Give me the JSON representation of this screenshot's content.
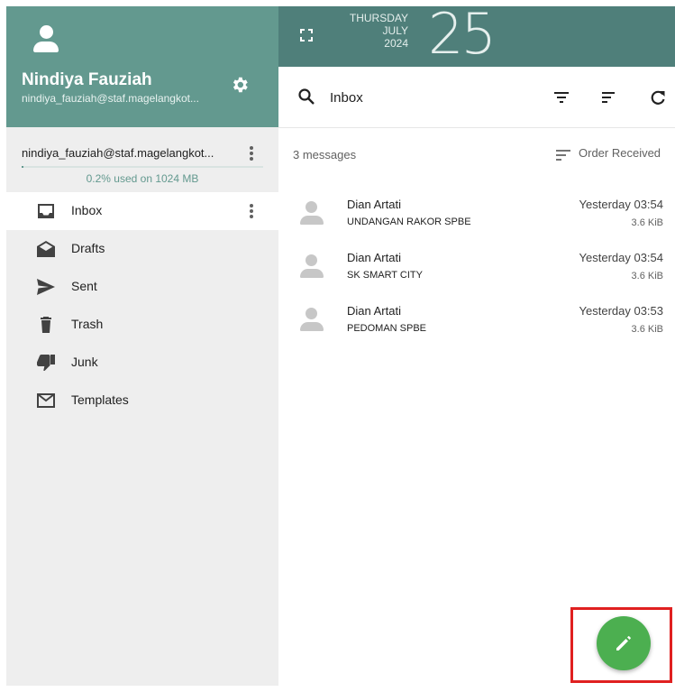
{
  "user": {
    "name": "Nindiya Fauziah",
    "email_header": "nindiya_fauziah@staf.magelangkot..."
  },
  "account": {
    "email": "nindiya_fauziah@staf.magelangkot...",
    "quota_text": "0.2% used on 1024 MB",
    "quota_fraction": 0.002
  },
  "folders": [
    {
      "label": "Inbox",
      "icon": "inbox-icon",
      "active": true
    },
    {
      "label": "Drafts",
      "icon": "drafts-icon"
    },
    {
      "label": "Sent",
      "icon": "send-icon"
    },
    {
      "label": "Trash",
      "icon": "trash-icon"
    },
    {
      "label": "Junk",
      "icon": "thumbs-down-icon"
    },
    {
      "label": "Templates",
      "icon": "envelope-icon"
    }
  ],
  "date": {
    "weekday": "THURSDAY",
    "month": "JULY",
    "year": "2024",
    "day": "25"
  },
  "listbar": {
    "folder_title": "Inbox"
  },
  "list": {
    "count_text": "3 messages",
    "order_label": "Order Received"
  },
  "messages": [
    {
      "from": "Dian Artati",
      "subject": "UNDANGAN RAKOR SPBE",
      "date": "Yesterday 03:54",
      "size": "3.6 KiB"
    },
    {
      "from": "Dian Artati",
      "subject": "SK SMART CITY",
      "date": "Yesterday 03:54",
      "size": "3.6 KiB"
    },
    {
      "from": "Dian Artati",
      "subject": "PEDOMAN SPBE",
      "date": "Yesterday 03:53",
      "size": "3.6 KiB"
    }
  ],
  "colors": {
    "header_teal": "#63998f",
    "topbar_teal": "#4f7f7a",
    "fab_green": "#4caf50",
    "highlight_red": "#e02020"
  }
}
